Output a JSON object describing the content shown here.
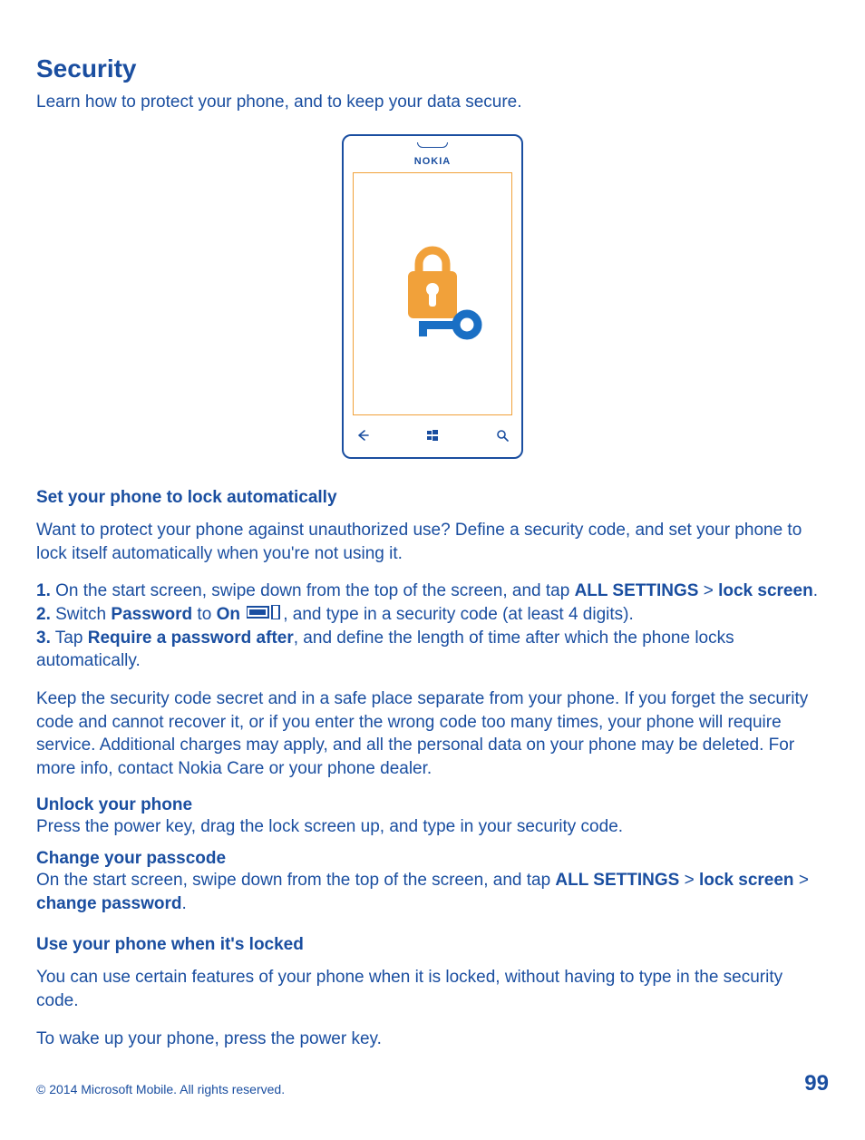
{
  "title": "Security",
  "intro": "Learn how to protect your phone, and to keep your data secure.",
  "phone_brand": "NOKIA",
  "section1": {
    "heading": "Set your phone to lock automatically",
    "para": "Want to protect your phone against unauthorized use? Define a security code, and set your phone to lock itself automatically when you're not using it.",
    "step1_num": "1.",
    "step1_a": " On the start screen, swipe down from the top of the screen, and tap ",
    "step1_b": "ALL SETTINGS",
    "step1_c": " > ",
    "step1_d": "lock screen",
    "step1_e": ".",
    "step2_num": "2.",
    "step2_a": " Switch ",
    "step2_b": "Password",
    "step2_c": " to ",
    "step2_d": "On",
    "step2_e": " ",
    "step2_f": ", and type in a security code (at least 4 digits).",
    "step3_num": "3.",
    "step3_a": " Tap ",
    "step3_b": "Require a password after",
    "step3_c": ", and define the length of time after which the phone locks automatically.",
    "note": "Keep the security code secret and in a safe place separate from your phone. If you forget the security code and cannot recover it, or if you enter the wrong code too many times, your phone will require service. Additional charges may apply, and all the personal data on your phone may be deleted. For more info, contact Nokia Care or your phone dealer."
  },
  "section2": {
    "heading": "Unlock your phone",
    "text": "Press the power key, drag the lock screen up, and type in your security code."
  },
  "section3": {
    "heading": "Change your passcode",
    "text_a": "On the start screen, swipe down from the top of the screen, and tap ",
    "text_b": "ALL SETTINGS",
    "text_c": " > ",
    "text_d": "lock screen",
    "text_e": " > ",
    "text_f": "change password",
    "text_g": "."
  },
  "section4": {
    "heading": "Use your phone when it's locked",
    "para1": "You can use certain features of your phone when it is locked, without having to type in the security code.",
    "para2": "To wake up your phone, press the power key."
  },
  "footer": {
    "copyright": "© 2014 Microsoft Mobile. All rights reserved.",
    "page": "99"
  }
}
